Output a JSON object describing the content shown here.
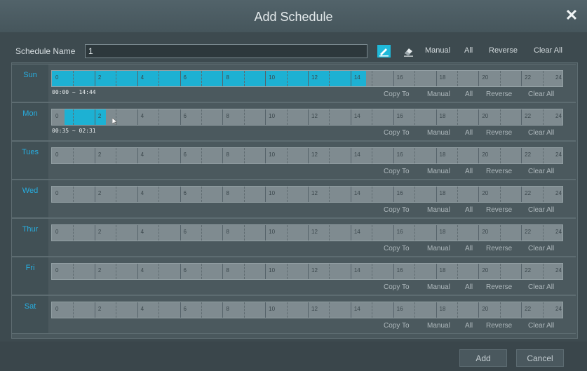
{
  "dialog": {
    "title": "Add Schedule"
  },
  "name_row": {
    "label": "Schedule Name",
    "value": "1",
    "links": [
      "Manual",
      "All",
      "Reverse",
      "Clear All"
    ]
  },
  "hours": [
    "0",
    "2",
    "4",
    "6",
    "8",
    "10",
    "12",
    "14",
    "16",
    "18",
    "20",
    "22",
    "24"
  ],
  "row_actions": [
    "Copy To",
    "Manual",
    "All",
    "Reverse",
    "Clear All"
  ],
  "days": [
    {
      "name": "Sun",
      "range_text": "00:00 ~ 14:44",
      "start_h": 0,
      "end_h": 14.733
    },
    {
      "name": "Mon",
      "range_text": "00:35 ~ 02:31",
      "start_h": 0.583,
      "end_h": 2.517
    },
    {
      "name": "Tues",
      "range_text": ""
    },
    {
      "name": "Wed",
      "range_text": ""
    },
    {
      "name": "Thur",
      "range_text": ""
    },
    {
      "name": "Fri",
      "range_text": ""
    },
    {
      "name": "Sat",
      "range_text": ""
    }
  ],
  "buttons": {
    "add": "Add",
    "cancel": "Cancel"
  },
  "colors": {
    "accent": "#1db1d3",
    "day_label": "#27aee0",
    "background": "#3d4a4f"
  },
  "icons": [
    "close-icon",
    "brush-icon",
    "eraser-icon",
    "cursor-icon"
  ]
}
